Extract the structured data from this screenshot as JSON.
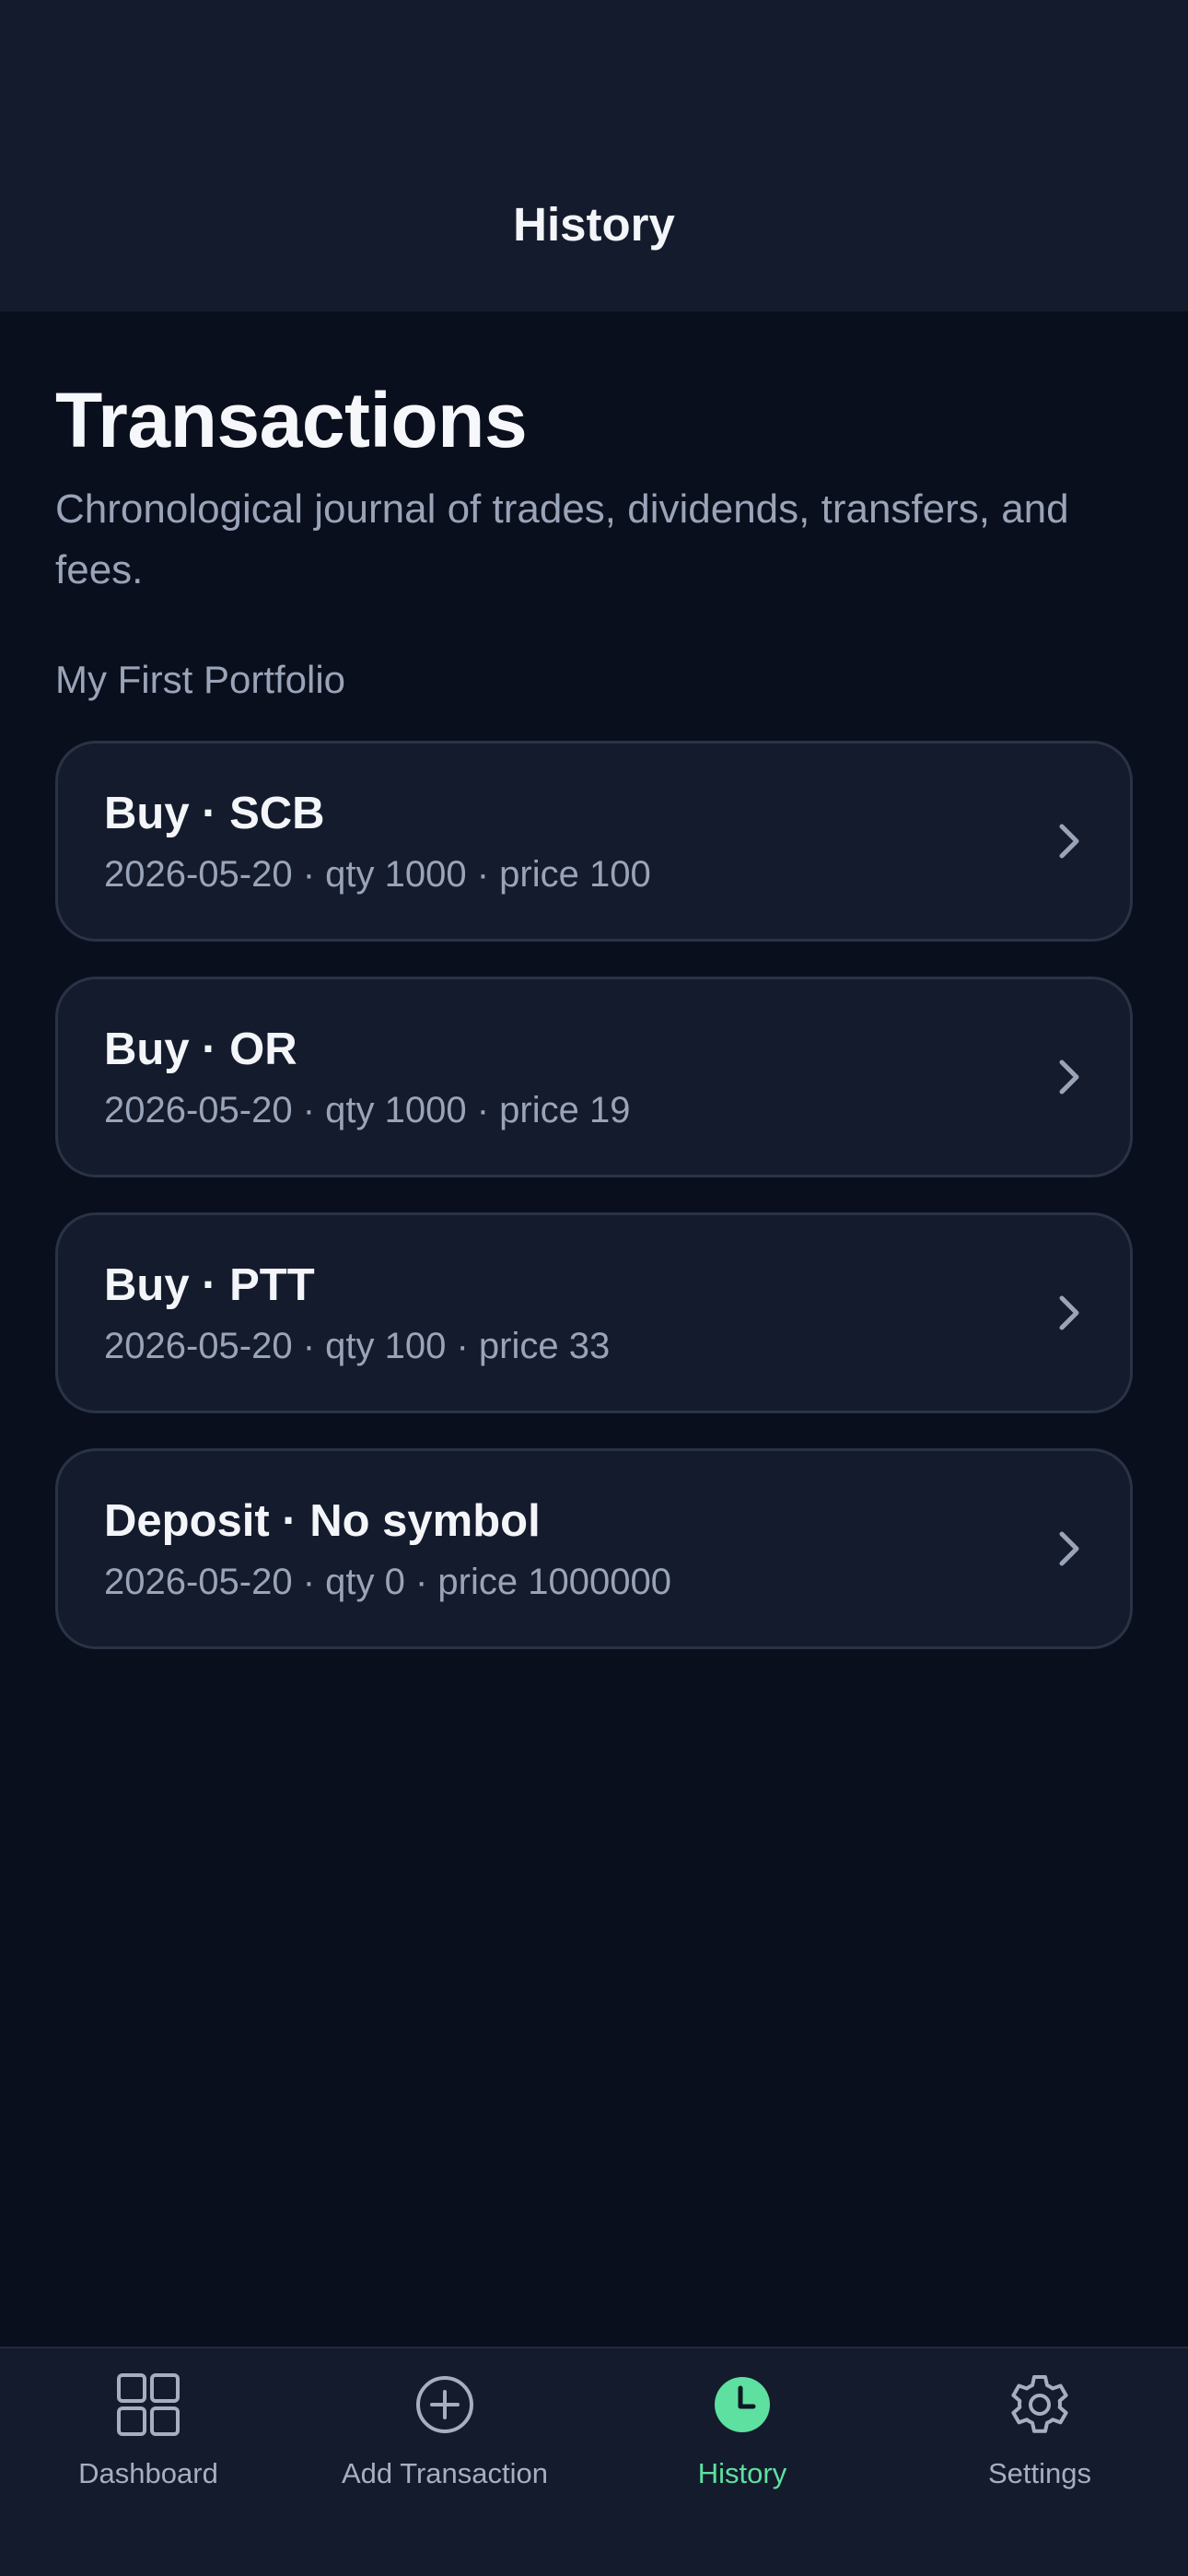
{
  "nav": {
    "title": "History"
  },
  "page": {
    "title": "Transactions",
    "subtitle": "Chronological journal of trades, dividends, transfers, and fees.",
    "portfolio_name": "My First Portfolio"
  },
  "transactions": [
    {
      "title": "Buy · SCB",
      "meta": "2026-05-20 · qty 1000 · price 100"
    },
    {
      "title": "Buy · OR",
      "meta": "2026-05-20 · qty 1000 · price 19"
    },
    {
      "title": "Buy · PTT",
      "meta": "2026-05-20 · qty 100 · price 33"
    },
    {
      "title": "Deposit · No symbol",
      "meta": "2026-05-20 · qty 0 · price 1000000"
    }
  ],
  "tabs": [
    {
      "label": "Dashboard",
      "icon": "grid-icon",
      "active": false
    },
    {
      "label": "Add Transaction",
      "icon": "plus-circle-icon",
      "active": false
    },
    {
      "label": "History",
      "icon": "clock-icon",
      "active": true
    },
    {
      "label": "Settings",
      "icon": "gear-icon",
      "active": false
    }
  ],
  "colors": {
    "background": "#0a0f1d",
    "surface": "#141b2c",
    "border": "#2a3346",
    "text_primary": "#f3f5f9",
    "text_secondary": "#9aa4b8",
    "accent": "#5ee0a0"
  }
}
